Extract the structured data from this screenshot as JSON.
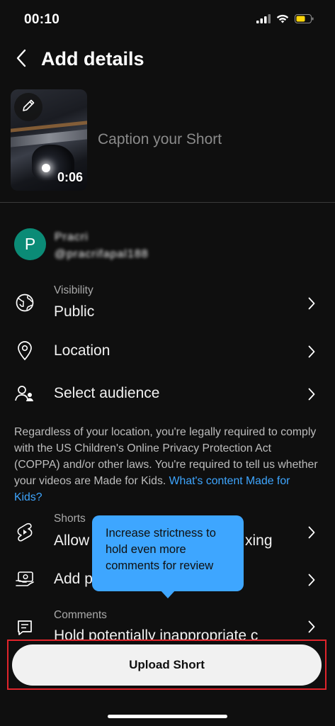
{
  "status_bar": {
    "time": "00:10",
    "battery_color": "#ffd60a"
  },
  "header": {
    "title": "Add details"
  },
  "thumbnail": {
    "duration": "0:06"
  },
  "caption": {
    "placeholder": "Caption your Short"
  },
  "account": {
    "avatar_letter": "P",
    "name": "Pracri",
    "handle": "@pracrifapal188"
  },
  "rows": [
    {
      "icon": "globe-icon",
      "label": "Visibility",
      "value": "Public"
    },
    {
      "icon": "location-pin-icon",
      "label": "",
      "value": "Location"
    },
    {
      "icon": "audience-icon",
      "label": "",
      "value": "Select audience"
    }
  ],
  "notice": {
    "text": "Regardless of your location, you're legally required to comply with the US Children's Online Privacy Protection Act (COPPA) and/or other laws. You're required to tell us whether your videos are Made for Kids. ",
    "link": "What's content Made for Kids?"
  },
  "remix_row": {
    "icon": "shorts-remix-icon",
    "label": "Shorts",
    "value_start": "Allow",
    "value_end": "xing"
  },
  "paid_row": {
    "icon": "paid-promotion-icon",
    "value_start": "Add p"
  },
  "comments_row": {
    "icon": "comments-icon",
    "label": "Comments",
    "value": "Hold potentially inappropriate c"
  },
  "tooltip": {
    "text": "Increase strictness to hold even more comments for review",
    "color": "#3ea6ff"
  },
  "upload": {
    "label": "Upload Short"
  },
  "colors": {
    "accent": "#3ea6ff",
    "avatar": "#0b8b76",
    "highlight_border": "#e0242b"
  }
}
